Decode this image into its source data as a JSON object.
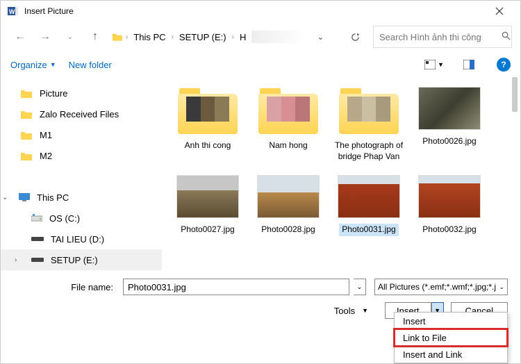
{
  "titlebar": {
    "title": "Insert Picture"
  },
  "breadcrumb": {
    "items": [
      "This PC",
      "SETUP (E:)",
      "H"
    ]
  },
  "search": {
    "placeholder": "Search Hình ảnh thi công"
  },
  "toolbar": {
    "organize": "Organize",
    "newfolder": "New folder"
  },
  "sidebar": {
    "items": [
      {
        "label": "Picture"
      },
      {
        "label": "Zalo Received Files"
      },
      {
        "label": "M1"
      },
      {
        "label": "M2"
      }
    ],
    "thispc": "This PC",
    "drives": [
      {
        "label": "OS (C:)"
      },
      {
        "label": "TAI LIEU (D:)"
      },
      {
        "label": "SETUP (E:)"
      }
    ]
  },
  "folders": [
    {
      "label": "Anh thi cong",
      "colors": [
        "#3a3a3a",
        "#6b5a3e",
        "#8a7a55"
      ]
    },
    {
      "label": "Nam hong",
      "colors": [
        "#d9a1a4",
        "#d88f94",
        "#bb7678"
      ]
    },
    {
      "label": "The photograph of bridge Phap Van",
      "colors": [
        "#b8a889",
        "#cbbfa3",
        "#a89a7d"
      ]
    }
  ],
  "photos_row1": [
    {
      "label": "Photo0026.jpg",
      "grad": "linear-gradient(135deg,#6a6a5a,#3e3e30,#8c8c74)"
    }
  ],
  "photos_row2": [
    {
      "label": "Photo0027.jpg",
      "grad": "linear-gradient(#c7c7c7 35%,#8a7a58 35%,#5a4b32)"
    },
    {
      "label": "Photo0028.jpg",
      "grad": "linear-gradient(#d8e0e7 40%,#b98a4a 40%,#7a5a34)"
    },
    {
      "label": "Photo0031.jpg",
      "grad": "linear-gradient(#d8e0e7 20%,#a63a1a 20%,#8a2f14)",
      "selected": true
    },
    {
      "label": "Photo0032.jpg",
      "grad": "linear-gradient(#d8e0e7 18%,#b24420 18%,#8a2f14)"
    }
  ],
  "bottom": {
    "filename_label": "File name:",
    "filename_value": "Photo0031.jpg",
    "filter": "All Pictures (*.emf;*.wmf;*.jpg;*.j",
    "tools": "Tools",
    "insert": "Insert",
    "cancel": "Cancel"
  },
  "dropdown": {
    "items": [
      "Insert",
      "Link to File",
      "Insert and Link"
    ]
  }
}
